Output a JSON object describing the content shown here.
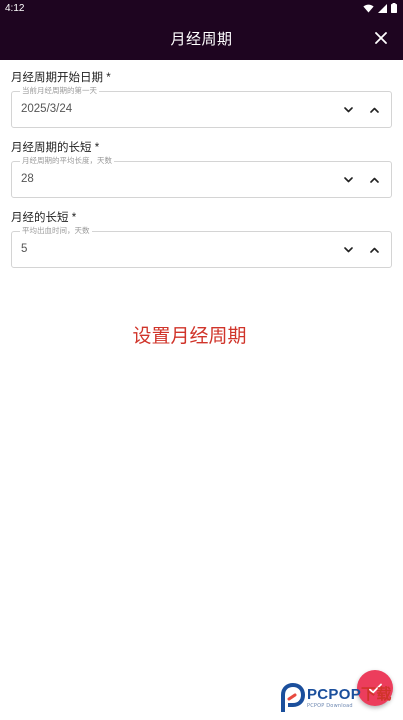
{
  "status_bar": {
    "time": "4:12"
  },
  "app_bar": {
    "title": "月经周期"
  },
  "fields": [
    {
      "label": "月经周期开始日期 *",
      "hint": "当前月经周期的第一天",
      "value": "2025/3/24"
    },
    {
      "label": "月经周期的长短 *",
      "hint": "月经周期的平均长度，天数",
      "value": "28"
    },
    {
      "label": "月经的长短 *",
      "hint": "平均出血时间，天数",
      "value": "5"
    }
  ],
  "center_title": "设置月经周期",
  "watermark": {
    "brand": "PCPOP",
    "suffix": "下载",
    "sub": "PCPOP Download"
  },
  "colors": {
    "app_bar_bg": "#1e0520",
    "center_title": "#d0342a",
    "fab_bg": "#ec3d5c",
    "field_border": "#d4d4d4"
  },
  "icons": {
    "close": "close-icon",
    "stepper_down": "chevron-down-icon",
    "stepper_up": "chevron-up-icon",
    "fab": "check-icon",
    "wifi": "wifi-icon",
    "signal": "signal-icon",
    "battery": "battery-icon"
  }
}
